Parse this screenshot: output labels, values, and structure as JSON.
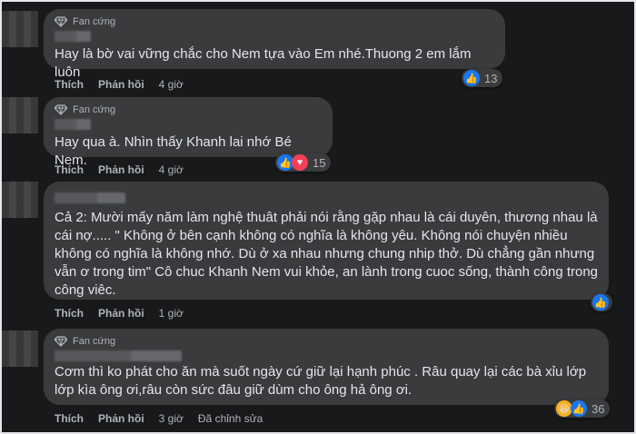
{
  "comments": [
    {
      "badge": "Fan cứng",
      "text": "Hay là bờ vai vững chắc cho Nem tựa vào Em nhé.Thuong 2 em lắm luôn",
      "actions": {
        "like": "Thích",
        "reply": "Phản hồi",
        "time": "4 giờ",
        "edited": ""
      },
      "reactions": {
        "types": [
          "like"
        ],
        "count": "13"
      }
    },
    {
      "badge": "Fan cứng",
      "text": "Hay qua à. Nhìn thấy Khanh lai nhớ Bé Nem.",
      "actions": {
        "like": "Thích",
        "reply": "Phản hồi",
        "time": "4 giờ",
        "edited": ""
      },
      "reactions": {
        "types": [
          "like",
          "love"
        ],
        "count": "15"
      }
    },
    {
      "badge": "",
      "text": "Cả 2: Mười mấy năm làm nghệ thuât phải nói rằng gặp nhau là cái duyên, thương nhau là cái nợ..... \" Không ở bên cạnh không có nghĩa là không yêu. Không nói chuyện nhiều không có nghĩa là không nhớ. Dù ở xa nhau nhưng chung nhip thở. Dù chẳng gần nhưng vẫn ơ trong tim\" Cô chuc Khanh Nem vui khỏe, an lành trong cuoc sống, thành công trong công viêc.",
      "actions": {
        "like": "Thích",
        "reply": "Phản hồi",
        "time": "1 giờ",
        "edited": ""
      },
      "reactions": {
        "types": [
          "like"
        ],
        "count": ""
      }
    },
    {
      "badge": "Fan cứng",
      "text": "Cơm thì ko phát cho ăn mà suốt ngày cứ giữ lại hạnh phúc . Râu quay lại các bà xỉu lớp lớp kìa ông ơi,râu còn sức đâu giữ dùm cho ông hả ông ơi.",
      "actions": {
        "like": "Thích",
        "reply": "Phản hồi",
        "time": "3 giờ",
        "edited": "Đã chỉnh sửa"
      },
      "reactions": {
        "types": [
          "haha",
          "like"
        ],
        "count": "36"
      }
    }
  ],
  "colors": {
    "background": "#18191a",
    "bubble": "#3a3b3c",
    "like": "#1877f2",
    "love": "#f33e58",
    "haha": "#f7b125"
  },
  "icons": {
    "badge": "diamond-badge-icon",
    "like": "thumbs-up-icon",
    "love": "heart-icon",
    "haha": "laughing-face-icon"
  }
}
